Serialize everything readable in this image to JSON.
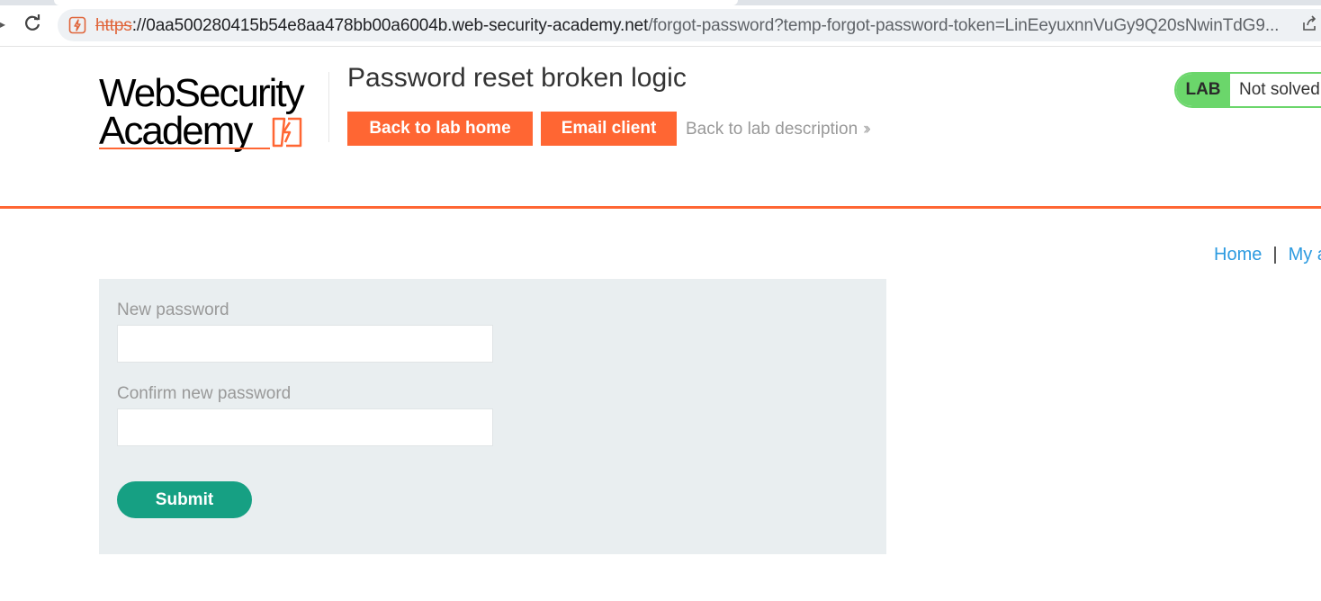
{
  "browser": {
    "url_scheme": "https",
    "url_host": "://0aa500280415b54e8aa478bb00a6004b.web-security-academy.net",
    "url_path": "/forgot-password?temp-forgot-password-token=LinEeyuxnnVuGy9Q20sNwinTdG9...",
    "icons": [
      "reload-icon",
      "site-icon",
      "share-icon"
    ]
  },
  "header": {
    "logo_line1": "WebSecurity",
    "logo_line2": "Academy",
    "lab_title": "Password reset broken logic",
    "back_to_lab_home": "Back to lab home",
    "email_client": "Email client",
    "back_to_lab_description": "Back to lab description",
    "lab_badge_label": "LAB",
    "lab_status": "Not solved"
  },
  "nav": {
    "home": "Home",
    "separator": "|",
    "my_account": "My a"
  },
  "form": {
    "new_password_label": "New password",
    "new_password_value": "",
    "confirm_password_label": "Confirm new password",
    "confirm_password_value": "",
    "submit_label": "Submit"
  },
  "colors": {
    "accent_orange": "#ff6633",
    "lab_green": "#6bd66b",
    "submit_green": "#16a083",
    "link_blue": "#2d9be0",
    "panel_bg": "#e9eef0"
  }
}
